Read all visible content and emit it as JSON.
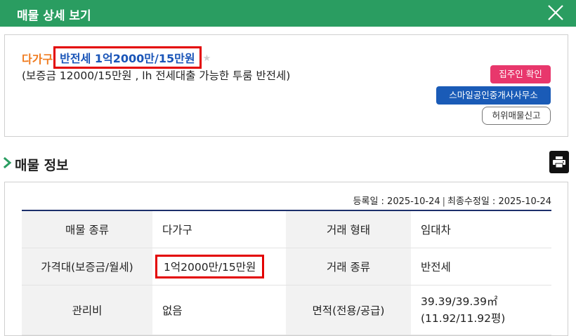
{
  "titlebar": {
    "title": "매물 상세 보기"
  },
  "summary": {
    "property_type": "다가구",
    "price_headline": "반전세 1억2000만/15만원",
    "description": "(보증금 12000/15만원 , lh 전세대출 가능한 투룸 반전세)",
    "badges": {
      "verify": "집주인 확인",
      "agency": "스마일공인중개사사무소",
      "report": "허위매물신고"
    }
  },
  "section": {
    "title": "매물 정보"
  },
  "dates": {
    "registered": "등록일 : 2025-10-24",
    "modified": "최종수정일 : 2025-10-24"
  },
  "table": [
    {
      "label1": "매물 종류",
      "value1": "다가구",
      "label2": "거래 형태",
      "value2": "임대차"
    },
    {
      "label1": "가격대(보증금/월세)",
      "value1": "1억2000만/15만원",
      "label2": "거래 종류",
      "value2": "반전세"
    },
    {
      "label1": "관리비",
      "value1": "없음",
      "label2": "면적(전용/공급)",
      "value2_line1": "39.39/39.39㎡",
      "value2_line2": "(11.92/11.92평)"
    }
  ],
  "colors": {
    "header_green": "#2a9d61",
    "price_blue": "#1a55b8",
    "highlight_red": "#e30000",
    "type_orange": "#f07c20",
    "verify_pink": "#e8376c",
    "agency_blue": "#1a5bb7",
    "table_border_navy": "#1c2f6b"
  },
  "icons": {
    "close": "close-icon",
    "section": "chevron-right-icon",
    "print": "printer-icon",
    "favorite": "star-icon"
  }
}
